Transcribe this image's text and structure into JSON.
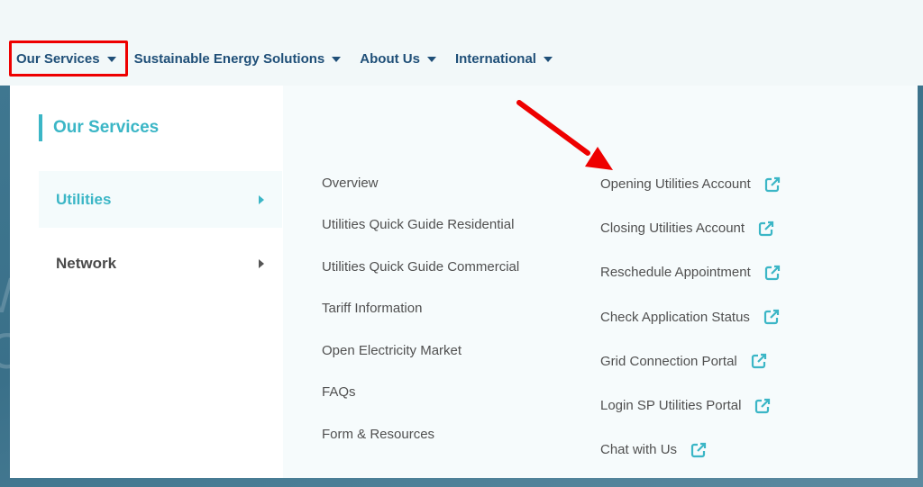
{
  "nav": {
    "items": [
      {
        "label": "Our Services",
        "highlighted": true
      },
      {
        "label": "Sustainable Energy Solutions"
      },
      {
        "label": "About Us"
      },
      {
        "label": "International"
      }
    ]
  },
  "menu": {
    "section_title": "Our Services",
    "categories": [
      {
        "label": "Utilities",
        "active": true
      },
      {
        "label": "Network",
        "active": false
      }
    ],
    "links_column_1": [
      "Overview",
      "Utilities Quick Guide Residential",
      "Utilities Quick Guide Commercial",
      "Tariff Information",
      "Open Electricity Market",
      "FAQs",
      "Form & Resources"
    ],
    "links_column_2": [
      {
        "label": "Opening Utilities Account",
        "icon": "external-link-icon"
      },
      {
        "label": "Closing Utilities Account",
        "icon": "external-link-icon"
      },
      {
        "label": "Reschedule Appointment",
        "icon": "external-link-icon"
      },
      {
        "label": "Check Application Status",
        "icon": "external-link-icon"
      },
      {
        "label": "Grid Connection Portal",
        "icon": "external-link-icon"
      },
      {
        "label": "Login SP Utilities Portal",
        "icon": "external-link-icon"
      },
      {
        "label": "Chat with Us",
        "icon": "external-link-icon"
      }
    ]
  },
  "background": {
    "ghost_letters": [
      "W",
      "C"
    ]
  },
  "annotation": {
    "type": "red-arrow",
    "points_to": "Opening Utilities Account",
    "color": "#ee0000"
  },
  "colors": {
    "nav_text": "#1f4f78",
    "accent": "#3bb6c6",
    "link_text": "#505050",
    "highlight_box": "#ee0000"
  }
}
